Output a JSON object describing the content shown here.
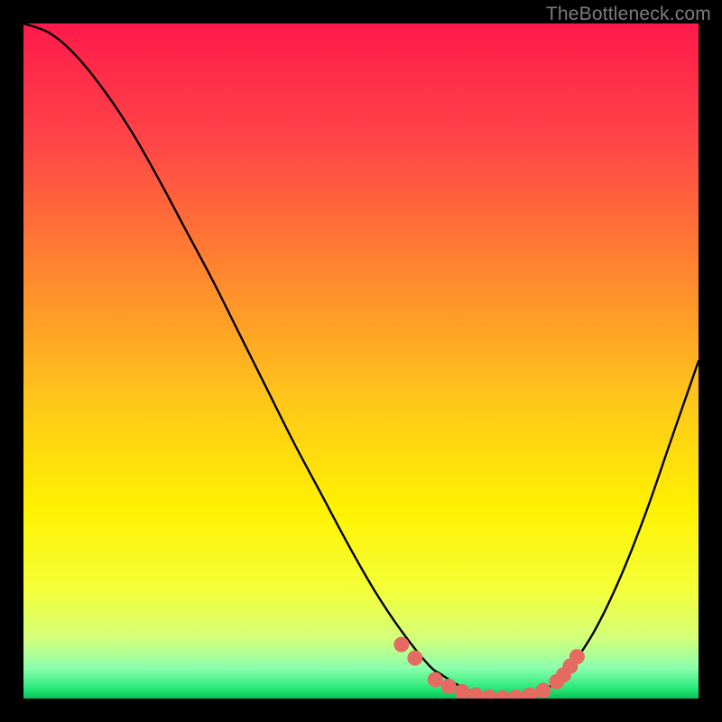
{
  "watermark": "TheBottleneck.com",
  "chart_data": {
    "type": "line",
    "title": "",
    "xlabel": "",
    "ylabel": "",
    "xlim": [
      0,
      100
    ],
    "ylim": [
      0,
      100
    ],
    "grid": false,
    "series": [
      {
        "name": "bottleneck-curve",
        "color": "#000000",
        "x": [
          0,
          4,
          8,
          12,
          16,
          20,
          24,
          28,
          32,
          36,
          40,
          44,
          48,
          52,
          56,
          60,
          62,
          64,
          66,
          68,
          70,
          72,
          74,
          76,
          78,
          80,
          84,
          88,
          92,
          96,
          100
        ],
        "y": [
          100,
          98.5,
          95,
          90,
          84,
          77,
          69.5,
          62,
          54,
          46,
          38,
          30.5,
          23,
          16,
          10,
          5,
          3.5,
          2.2,
          1.2,
          0.6,
          0.2,
          0.1,
          0.3,
          0.8,
          1.8,
          3.5,
          9,
          17,
          27,
          38.5,
          50
        ]
      },
      {
        "name": "highlight-dots",
        "color": "#e46a62",
        "x": [
          56,
          58,
          61,
          63,
          65,
          67,
          69,
          71,
          73,
          75,
          77,
          79,
          80,
          81,
          82
        ],
        "y": [
          8.0,
          6.0,
          2.8,
          1.8,
          1.0,
          0.5,
          0.2,
          0.1,
          0.2,
          0.5,
          1.2,
          2.5,
          3.5,
          4.8,
          6.2
        ]
      }
    ],
    "background_gradient": {
      "stops": [
        {
          "offset": 0.0,
          "color": "#ff1a4b"
        },
        {
          "offset": 0.18,
          "color": "#ff4747"
        },
        {
          "offset": 0.38,
          "color": "#ff8a2d"
        },
        {
          "offset": 0.55,
          "color": "#ffc41b"
        },
        {
          "offset": 0.72,
          "color": "#fff200"
        },
        {
          "offset": 0.84,
          "color": "#f3ff3a"
        },
        {
          "offset": 0.91,
          "color": "#d4ff7a"
        },
        {
          "offset": 0.955,
          "color": "#8cffad"
        },
        {
          "offset": 0.985,
          "color": "#27e977"
        },
        {
          "offset": 1.0,
          "color": "#0bbf59"
        }
      ]
    }
  }
}
